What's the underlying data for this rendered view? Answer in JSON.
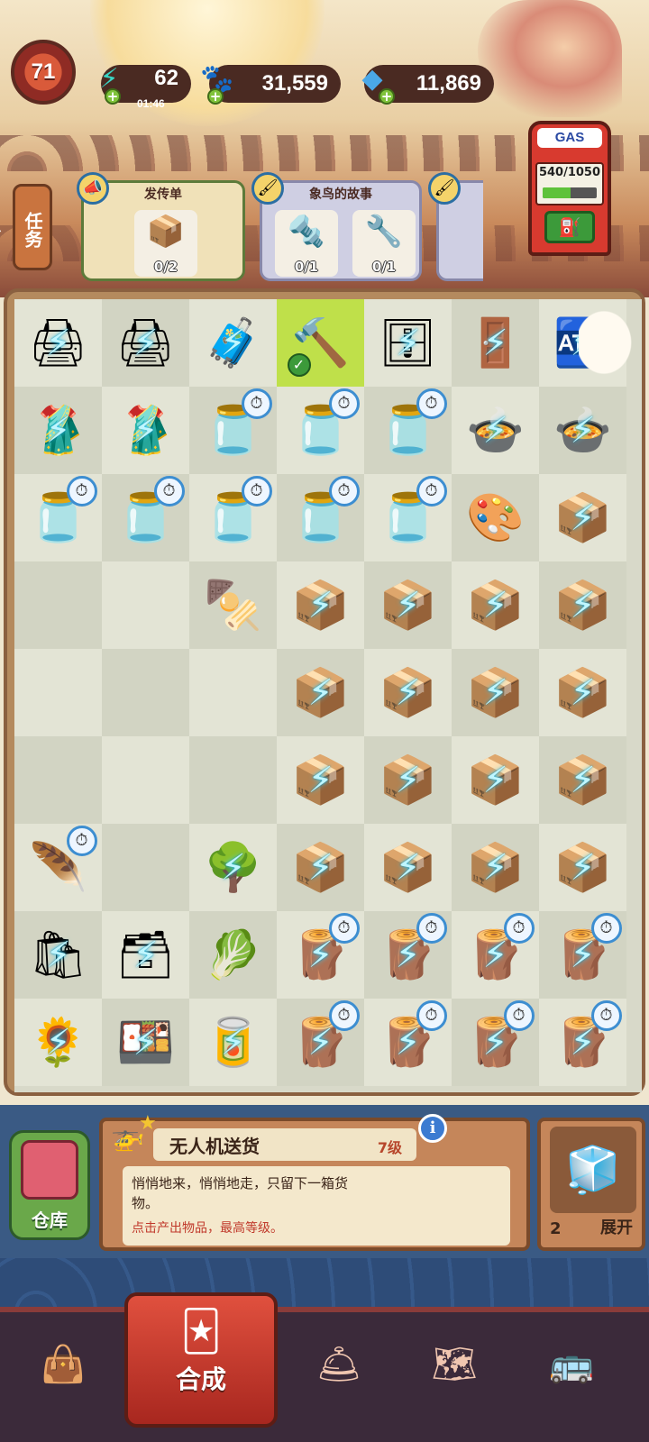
{
  "hud": {
    "level": "71",
    "energy": "62",
    "energy_timer": "01:46",
    "coins": "31,559",
    "gems": "11,869"
  },
  "gas": {
    "label": "GAS",
    "value": "540/1050",
    "fill_fraction": 0.51
  },
  "task_tab": {
    "label": "任务"
  },
  "orders": [
    {
      "title": "发传单",
      "items": [
        {
          "icon": "flyer-box-icon",
          "count": "0/2"
        }
      ]
    },
    {
      "title": "象鸟的故事",
      "items": [
        {
          "icon": "drill-icon",
          "count": "0/1"
        },
        {
          "icon": "wrench-icon",
          "count": "0/1"
        }
      ]
    }
  ],
  "board": {
    "rows": 9,
    "cols": 7,
    "selected_cell": "row-0-col-3"
  },
  "info_panel": {
    "item_name": "无人机送货",
    "item_level": "7级",
    "description": "悄悄地来，悄悄地走，只留下一箱货物。",
    "hint": "点击产出物品，最高等级。",
    "warehouse_label": "仓库",
    "expand_count": "2",
    "expand_label": "展开"
  },
  "nav": {
    "main_label": "合成",
    "items": [
      "shopping-bag-icon",
      "merge-cards-icon",
      "cloche-icon",
      "map-icon",
      "bus-icon"
    ]
  }
}
